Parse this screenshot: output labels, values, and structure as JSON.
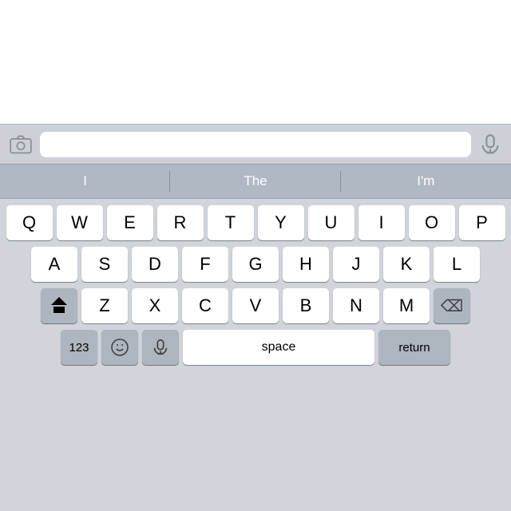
{
  "toolbar": {
    "camera_label": "📷",
    "mic_label": "🎙",
    "input_placeholder": ""
  },
  "suggestions": {
    "items": [
      {
        "label": "I"
      },
      {
        "label": "The"
      },
      {
        "label": "I'm"
      }
    ]
  },
  "keyboard": {
    "row1": [
      "Q",
      "W",
      "E",
      "R",
      "T",
      "Y",
      "U",
      "I",
      "O",
      "P"
    ],
    "row2": [
      "A",
      "S",
      "D",
      "F",
      "G",
      "H",
      "J",
      "K",
      "L"
    ],
    "row3": [
      "Z",
      "X",
      "C",
      "V",
      "B",
      "N",
      "M"
    ],
    "bottom": {
      "numbers": "123",
      "space": "space",
      "return": "return"
    }
  }
}
